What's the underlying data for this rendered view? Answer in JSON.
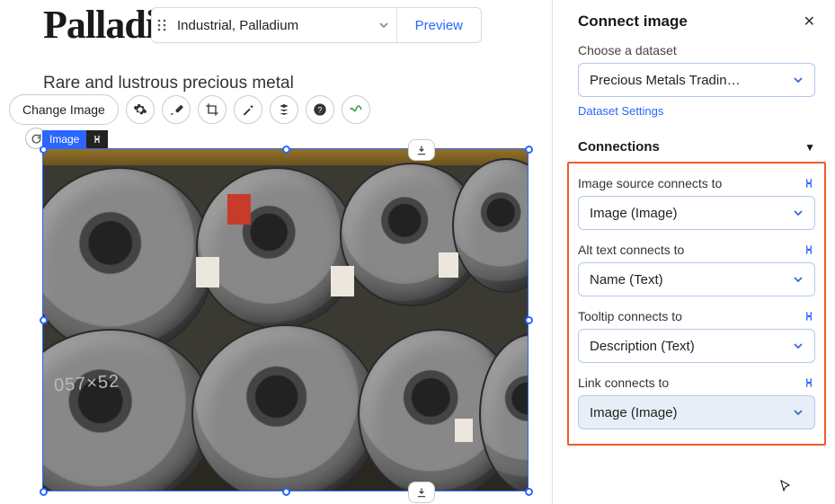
{
  "page": {
    "title": "Palladium",
    "subtitle": "Rare and lustrous precious metal"
  },
  "breadcrumb": {
    "text": "Industrial, Palladium",
    "preview_label": "Preview"
  },
  "toolbar": {
    "change_image_label": "Change Image"
  },
  "image_badge": {
    "label": "Image"
  },
  "canvas": {
    "graffiti_text": "057×52"
  },
  "sidebar": {
    "title": "Connect image",
    "dataset": {
      "label": "Choose a dataset",
      "selected": "Precious Metals Tradin…",
      "settings_link": "Dataset Settings"
    },
    "connections_title": "Connections",
    "rows": [
      {
        "label": "Image source connects to",
        "value": "Image (Image)"
      },
      {
        "label": "Alt text connects to",
        "value": "Name (Text)"
      },
      {
        "label": "Tooltip connects to",
        "value": "Description (Text)"
      },
      {
        "label": "Link connects to",
        "value": "Image (Image)"
      }
    ]
  }
}
